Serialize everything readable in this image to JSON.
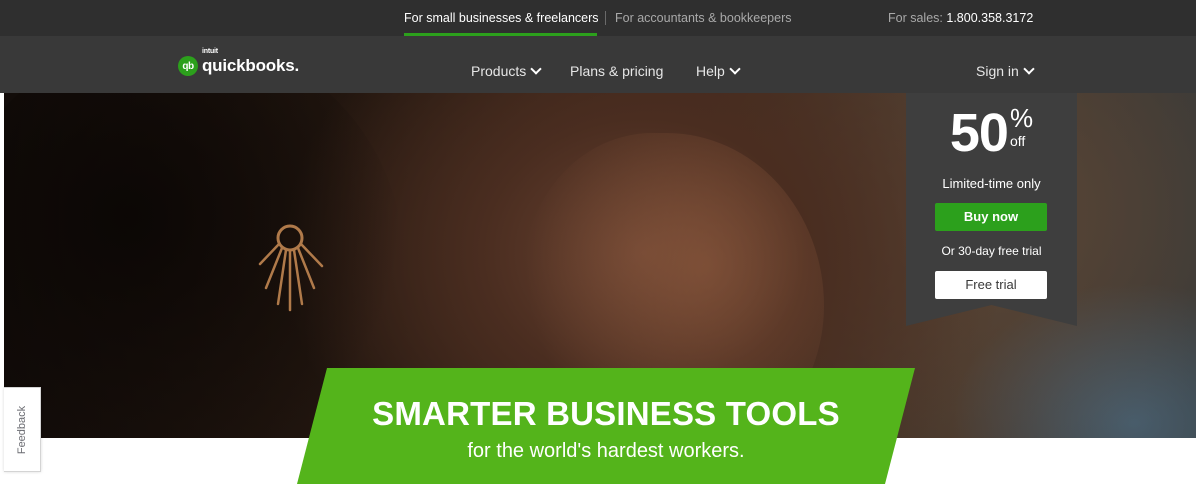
{
  "topbar": {
    "small_business": "For small businesses & freelancers",
    "accountants": "For accountants & bookkeepers",
    "sales_label": "For sales:",
    "sales_phone": "1.800.358.3172"
  },
  "nav": {
    "logo_badge": "qb",
    "logo_intuit": "intuit",
    "logo_text": "quickbooks.",
    "products": "Products",
    "plans": "Plans & pricing",
    "help": "Help",
    "sign_in": "Sign in"
  },
  "offer": {
    "number": "50",
    "percent": "%",
    "off": "off",
    "limited": "Limited-time only",
    "buy_now": "Buy now",
    "trial_text": "Or 30-day free trial",
    "free_trial": "Free trial"
  },
  "banner": {
    "title": "SMARTER BUSINESS TOOLS",
    "subtitle": "for the world's hardest workers."
  },
  "feedback": {
    "label": "Feedback"
  },
  "colors": {
    "brand_green": "#2ca01c",
    "banner_green": "#54b41b",
    "topbar_bg": "#2f2f2f",
    "nav_bg": "#393939"
  },
  "icons": [
    "chevron-down-icon",
    "quickbooks-logo-icon",
    "earring-graphic"
  ]
}
